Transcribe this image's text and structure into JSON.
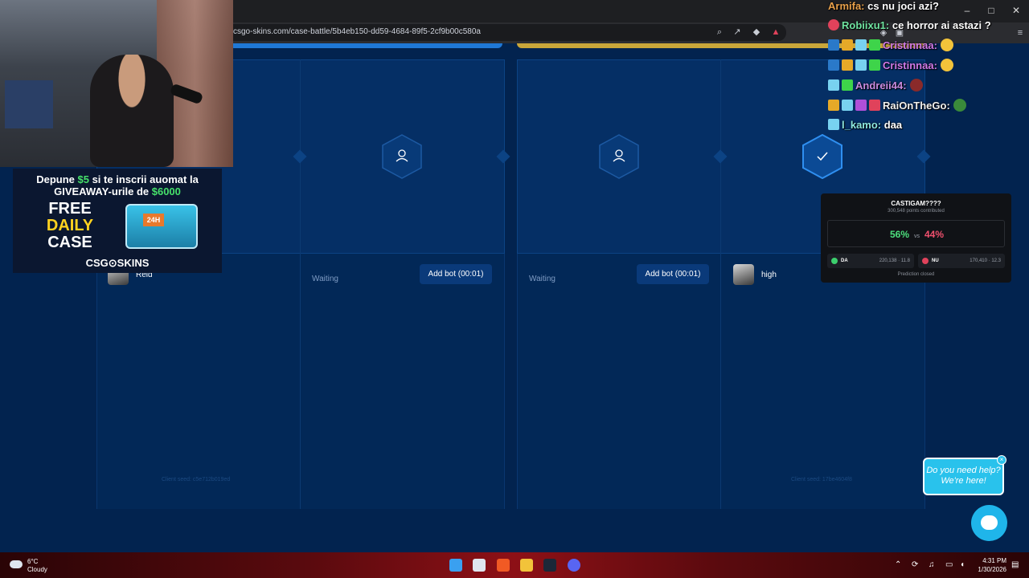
{
  "browser": {
    "url": "csgo-skins.com/case-battle/5b4eb150-dd59-4684-89f5-2cf9b00c580a",
    "window_controls": [
      "–",
      "□",
      "✕"
    ]
  },
  "battle": {
    "slots": [
      {
        "status": "",
        "player": "Reid"
      },
      {
        "status": "Waiting",
        "button": "Add bot (00:01)"
      },
      {
        "status": "Waiting",
        "button": "Add bot (00:01)"
      },
      {
        "status": "",
        "player": "high"
      }
    ],
    "client_seeds": [
      "Client seed: c5e712b019ed",
      "Client seed: 17be4604f8"
    ]
  },
  "promo": {
    "line1_pre": "Depune ",
    "line1_amount": "$5",
    "line1_post": " si te inscrii auomat la",
    "line2_pre": "GIVEAWAY-urile de ",
    "line2_amount": "$6000",
    "free": "FREE",
    "daily": "DAILY",
    "case": "CASE",
    "case_tag": "24H",
    "brand": "CSG⊙SKINS"
  },
  "chat": [
    {
      "user": "Armifa:",
      "user_color": "#e8a04a",
      "message": "cs nu joci azi?"
    },
    {
      "user": "Robiixu1:",
      "user_color": "#6fe3a0",
      "message": "ce horror ai astazi ?"
    },
    {
      "user": "Cristinnaa:",
      "user_color": "#d07ae8",
      "message": ""
    },
    {
      "user": "Cristinnaa:",
      "user_color": "#d07ae8",
      "message": ""
    },
    {
      "user": "Andreii44:",
      "user_color": "#c88be0",
      "message": ""
    },
    {
      "user": "RaiOnTheGo:",
      "user_color": "#f0f0f0",
      "message": ""
    },
    {
      "user": "l_kamo:",
      "user_color": "#8de8e0",
      "message": "daa"
    }
  ],
  "prediction": {
    "title": "CASTIGAM????",
    "subtitle": "300,548 points contributed",
    "pct_a": "56%",
    "vs": "vs",
    "pct_b": "44%",
    "option_a": {
      "label": "DA",
      "stats": "220,138 · 11.8",
      "color": "#3ccf6d"
    },
    "option_b": {
      "label": "NU",
      "stats": "170,410 · 12.3",
      "color": "#e0425b"
    },
    "status": "Prediction closed"
  },
  "help": {
    "line1": "Do you need help?",
    "line2": "We're here!",
    "close": "×"
  },
  "taskbar": {
    "temp": "6°C",
    "condition": "Cloudy",
    "time": "4:31 PM",
    "date": "1/30/2026"
  }
}
